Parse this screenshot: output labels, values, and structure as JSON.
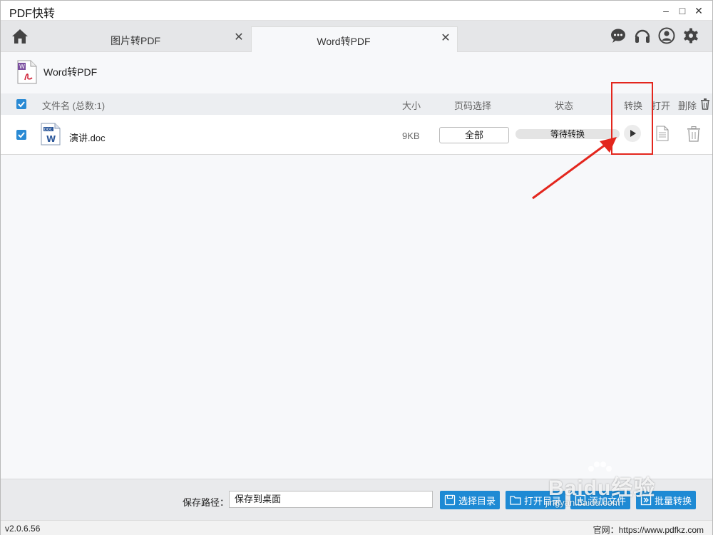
{
  "app": {
    "title": "PDF快转"
  },
  "window_controls": {
    "minimize": "–",
    "maximize": "□",
    "close": "✕"
  },
  "tabs": [
    {
      "label": "图片转PDF",
      "close": "✕",
      "active": false
    },
    {
      "label": "Word转PDF",
      "close": "✕",
      "active": true
    }
  ],
  "top_icons": [
    "chat-icon",
    "headset-icon",
    "user-icon",
    "gear-icon"
  ],
  "module": {
    "title": "Word转PDF"
  },
  "table": {
    "headers": {
      "filename": "文件名 (总数:1)",
      "size": "大小",
      "page_select": "页码选择",
      "status": "状态",
      "convert": "转换",
      "open": "打开",
      "delete": "删除"
    },
    "rows": [
      {
        "checked": true,
        "name": "演讲.doc",
        "size": "9KB",
        "page_select": "全部",
        "status": "等待转换"
      }
    ]
  },
  "bottom": {
    "save_label": "保存路径：",
    "save_path": "保存到桌面",
    "choose_dir": "选择目录",
    "open_dir": "打开目录",
    "add_file": "添加文件",
    "batch_convert": "批量转换"
  },
  "footer": {
    "version": "v2.0.6.56",
    "site": "官网：https://www.pdfkz.com"
  },
  "watermark": {
    "big": "Baidu经验",
    "small": "jingyan.baidu.com"
  },
  "colors": {
    "accent": "#1e8ad4",
    "annotation_red": "#e3261d",
    "word_blue": "#2b579a"
  }
}
